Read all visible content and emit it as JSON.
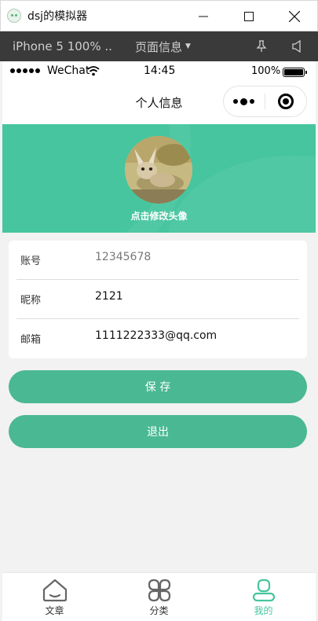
{
  "window": {
    "title": "dsj的模拟器"
  },
  "simulator": {
    "device": "iPhone 5 100% ...",
    "page_info": "页面信息"
  },
  "status_bar": {
    "carrier": "WeChat",
    "time": "14:45",
    "battery": "100%"
  },
  "nav": {
    "title": "个人信息"
  },
  "profile": {
    "avatar_hint": "点击修改头像"
  },
  "form": {
    "fields": [
      {
        "label": "账号",
        "value": "12345678"
      },
      {
        "label": "昵称",
        "value": "2121"
      },
      {
        "label": "邮箱",
        "value": "1111222333@qq.com"
      }
    ]
  },
  "buttons": {
    "save": "保 存",
    "logout": "退出"
  },
  "tabbar": {
    "items": [
      {
        "label": "文章",
        "icon": "home-icon"
      },
      {
        "label": "分类",
        "icon": "category-icon"
      },
      {
        "label": "我的",
        "icon": "person-icon"
      }
    ],
    "active": 2
  },
  "colors": {
    "accent": "#46c59e",
    "button": "#4ab893",
    "background": "#f2f2f2"
  }
}
